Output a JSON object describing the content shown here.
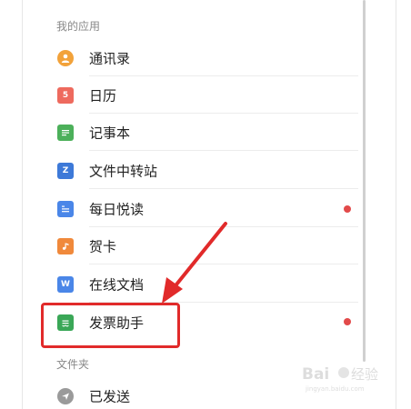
{
  "sections": {
    "apps_label": "我的应用",
    "folders_label": "文件夹"
  },
  "apps": [
    {
      "label": "通讯录",
      "icon": "contacts-icon",
      "color": "#f2a23a",
      "badge": false
    },
    {
      "label": "日历",
      "icon": "calendar-icon",
      "color": "#ee6a5e",
      "badge": false,
      "icon_text": "5"
    },
    {
      "label": "记事本",
      "icon": "notepad-icon",
      "color": "#4cb05a",
      "badge": false
    },
    {
      "label": "文件中转站",
      "icon": "file-transfer-icon",
      "color": "#3d79d8",
      "badge": false,
      "icon_text": "Z"
    },
    {
      "label": "每日悦读",
      "icon": "daily-reading-icon",
      "color": "#4a86e8",
      "badge": true
    },
    {
      "label": "贺卡",
      "icon": "greeting-card-icon",
      "color": "#f0893b",
      "badge": false
    },
    {
      "label": "在线文档",
      "icon": "online-doc-icon",
      "color": "#4a86e8",
      "badge": false,
      "icon_text": "W"
    },
    {
      "label": "发票助手",
      "icon": "invoice-assistant-icon",
      "color": "#3aa757",
      "badge": true
    }
  ],
  "folders": [
    {
      "label": "已发送",
      "icon": "sent-icon",
      "color": "#9a9a9a"
    }
  ],
  "colors": {
    "highlight": "#e12a2a",
    "badge": "#e24a4a"
  },
  "watermark": {
    "brand": "Baidu",
    "sub": "jingyan.baidu.com"
  }
}
